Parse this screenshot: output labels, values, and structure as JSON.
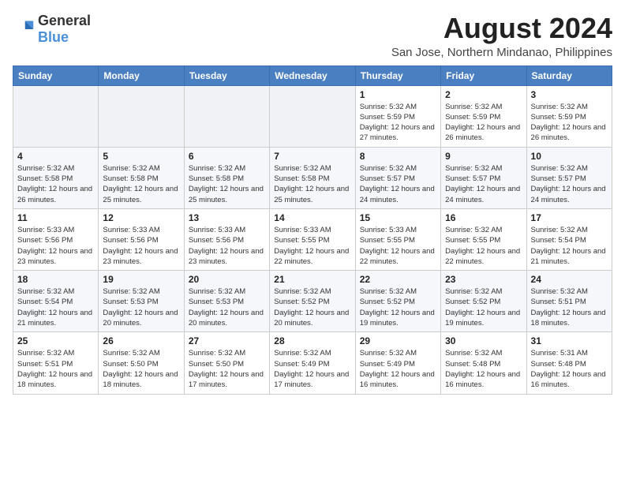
{
  "header": {
    "logo": {
      "general": "General",
      "blue": "Blue"
    },
    "title": "August 2024",
    "location": "San Jose, Northern Mindanao, Philippines"
  },
  "weekdays": [
    "Sunday",
    "Monday",
    "Tuesday",
    "Wednesday",
    "Thursday",
    "Friday",
    "Saturday"
  ],
  "weeks": [
    [
      {
        "day": "",
        "sunrise": "",
        "sunset": "",
        "daylight": ""
      },
      {
        "day": "",
        "sunrise": "",
        "sunset": "",
        "daylight": ""
      },
      {
        "day": "",
        "sunrise": "",
        "sunset": "",
        "daylight": ""
      },
      {
        "day": "",
        "sunrise": "",
        "sunset": "",
        "daylight": ""
      },
      {
        "day": "1",
        "sunrise": "Sunrise: 5:32 AM",
        "sunset": "Sunset: 5:59 PM",
        "daylight": "Daylight: 12 hours and 27 minutes."
      },
      {
        "day": "2",
        "sunrise": "Sunrise: 5:32 AM",
        "sunset": "Sunset: 5:59 PM",
        "daylight": "Daylight: 12 hours and 26 minutes."
      },
      {
        "day": "3",
        "sunrise": "Sunrise: 5:32 AM",
        "sunset": "Sunset: 5:59 PM",
        "daylight": "Daylight: 12 hours and 26 minutes."
      }
    ],
    [
      {
        "day": "4",
        "sunrise": "Sunrise: 5:32 AM",
        "sunset": "Sunset: 5:58 PM",
        "daylight": "Daylight: 12 hours and 26 minutes."
      },
      {
        "day": "5",
        "sunrise": "Sunrise: 5:32 AM",
        "sunset": "Sunset: 5:58 PM",
        "daylight": "Daylight: 12 hours and 25 minutes."
      },
      {
        "day": "6",
        "sunrise": "Sunrise: 5:32 AM",
        "sunset": "Sunset: 5:58 PM",
        "daylight": "Daylight: 12 hours and 25 minutes."
      },
      {
        "day": "7",
        "sunrise": "Sunrise: 5:32 AM",
        "sunset": "Sunset: 5:58 PM",
        "daylight": "Daylight: 12 hours and 25 minutes."
      },
      {
        "day": "8",
        "sunrise": "Sunrise: 5:32 AM",
        "sunset": "Sunset: 5:57 PM",
        "daylight": "Daylight: 12 hours and 24 minutes."
      },
      {
        "day": "9",
        "sunrise": "Sunrise: 5:32 AM",
        "sunset": "Sunset: 5:57 PM",
        "daylight": "Daylight: 12 hours and 24 minutes."
      },
      {
        "day": "10",
        "sunrise": "Sunrise: 5:32 AM",
        "sunset": "Sunset: 5:57 PM",
        "daylight": "Daylight: 12 hours and 24 minutes."
      }
    ],
    [
      {
        "day": "11",
        "sunrise": "Sunrise: 5:33 AM",
        "sunset": "Sunset: 5:56 PM",
        "daylight": "Daylight: 12 hours and 23 minutes."
      },
      {
        "day": "12",
        "sunrise": "Sunrise: 5:33 AM",
        "sunset": "Sunset: 5:56 PM",
        "daylight": "Daylight: 12 hours and 23 minutes."
      },
      {
        "day": "13",
        "sunrise": "Sunrise: 5:33 AM",
        "sunset": "Sunset: 5:56 PM",
        "daylight": "Daylight: 12 hours and 23 minutes."
      },
      {
        "day": "14",
        "sunrise": "Sunrise: 5:33 AM",
        "sunset": "Sunset: 5:55 PM",
        "daylight": "Daylight: 12 hours and 22 minutes."
      },
      {
        "day": "15",
        "sunrise": "Sunrise: 5:33 AM",
        "sunset": "Sunset: 5:55 PM",
        "daylight": "Daylight: 12 hours and 22 minutes."
      },
      {
        "day": "16",
        "sunrise": "Sunrise: 5:32 AM",
        "sunset": "Sunset: 5:55 PM",
        "daylight": "Daylight: 12 hours and 22 minutes."
      },
      {
        "day": "17",
        "sunrise": "Sunrise: 5:32 AM",
        "sunset": "Sunset: 5:54 PM",
        "daylight": "Daylight: 12 hours and 21 minutes."
      }
    ],
    [
      {
        "day": "18",
        "sunrise": "Sunrise: 5:32 AM",
        "sunset": "Sunset: 5:54 PM",
        "daylight": "Daylight: 12 hours and 21 minutes."
      },
      {
        "day": "19",
        "sunrise": "Sunrise: 5:32 AM",
        "sunset": "Sunset: 5:53 PM",
        "daylight": "Daylight: 12 hours and 20 minutes."
      },
      {
        "day": "20",
        "sunrise": "Sunrise: 5:32 AM",
        "sunset": "Sunset: 5:53 PM",
        "daylight": "Daylight: 12 hours and 20 minutes."
      },
      {
        "day": "21",
        "sunrise": "Sunrise: 5:32 AM",
        "sunset": "Sunset: 5:52 PM",
        "daylight": "Daylight: 12 hours and 20 minutes."
      },
      {
        "day": "22",
        "sunrise": "Sunrise: 5:32 AM",
        "sunset": "Sunset: 5:52 PM",
        "daylight": "Daylight: 12 hours and 19 minutes."
      },
      {
        "day": "23",
        "sunrise": "Sunrise: 5:32 AM",
        "sunset": "Sunset: 5:52 PM",
        "daylight": "Daylight: 12 hours and 19 minutes."
      },
      {
        "day": "24",
        "sunrise": "Sunrise: 5:32 AM",
        "sunset": "Sunset: 5:51 PM",
        "daylight": "Daylight: 12 hours and 18 minutes."
      }
    ],
    [
      {
        "day": "25",
        "sunrise": "Sunrise: 5:32 AM",
        "sunset": "Sunset: 5:51 PM",
        "daylight": "Daylight: 12 hours and 18 minutes."
      },
      {
        "day": "26",
        "sunrise": "Sunrise: 5:32 AM",
        "sunset": "Sunset: 5:50 PM",
        "daylight": "Daylight: 12 hours and 18 minutes."
      },
      {
        "day": "27",
        "sunrise": "Sunrise: 5:32 AM",
        "sunset": "Sunset: 5:50 PM",
        "daylight": "Daylight: 12 hours and 17 minutes."
      },
      {
        "day": "28",
        "sunrise": "Sunrise: 5:32 AM",
        "sunset": "Sunset: 5:49 PM",
        "daylight": "Daylight: 12 hours and 17 minutes."
      },
      {
        "day": "29",
        "sunrise": "Sunrise: 5:32 AM",
        "sunset": "Sunset: 5:49 PM",
        "daylight": "Daylight: 12 hours and 16 minutes."
      },
      {
        "day": "30",
        "sunrise": "Sunrise: 5:32 AM",
        "sunset": "Sunset: 5:48 PM",
        "daylight": "Daylight: 12 hours and 16 minutes."
      },
      {
        "day": "31",
        "sunrise": "Sunrise: 5:31 AM",
        "sunset": "Sunset: 5:48 PM",
        "daylight": "Daylight: 12 hours and 16 minutes."
      }
    ]
  ]
}
